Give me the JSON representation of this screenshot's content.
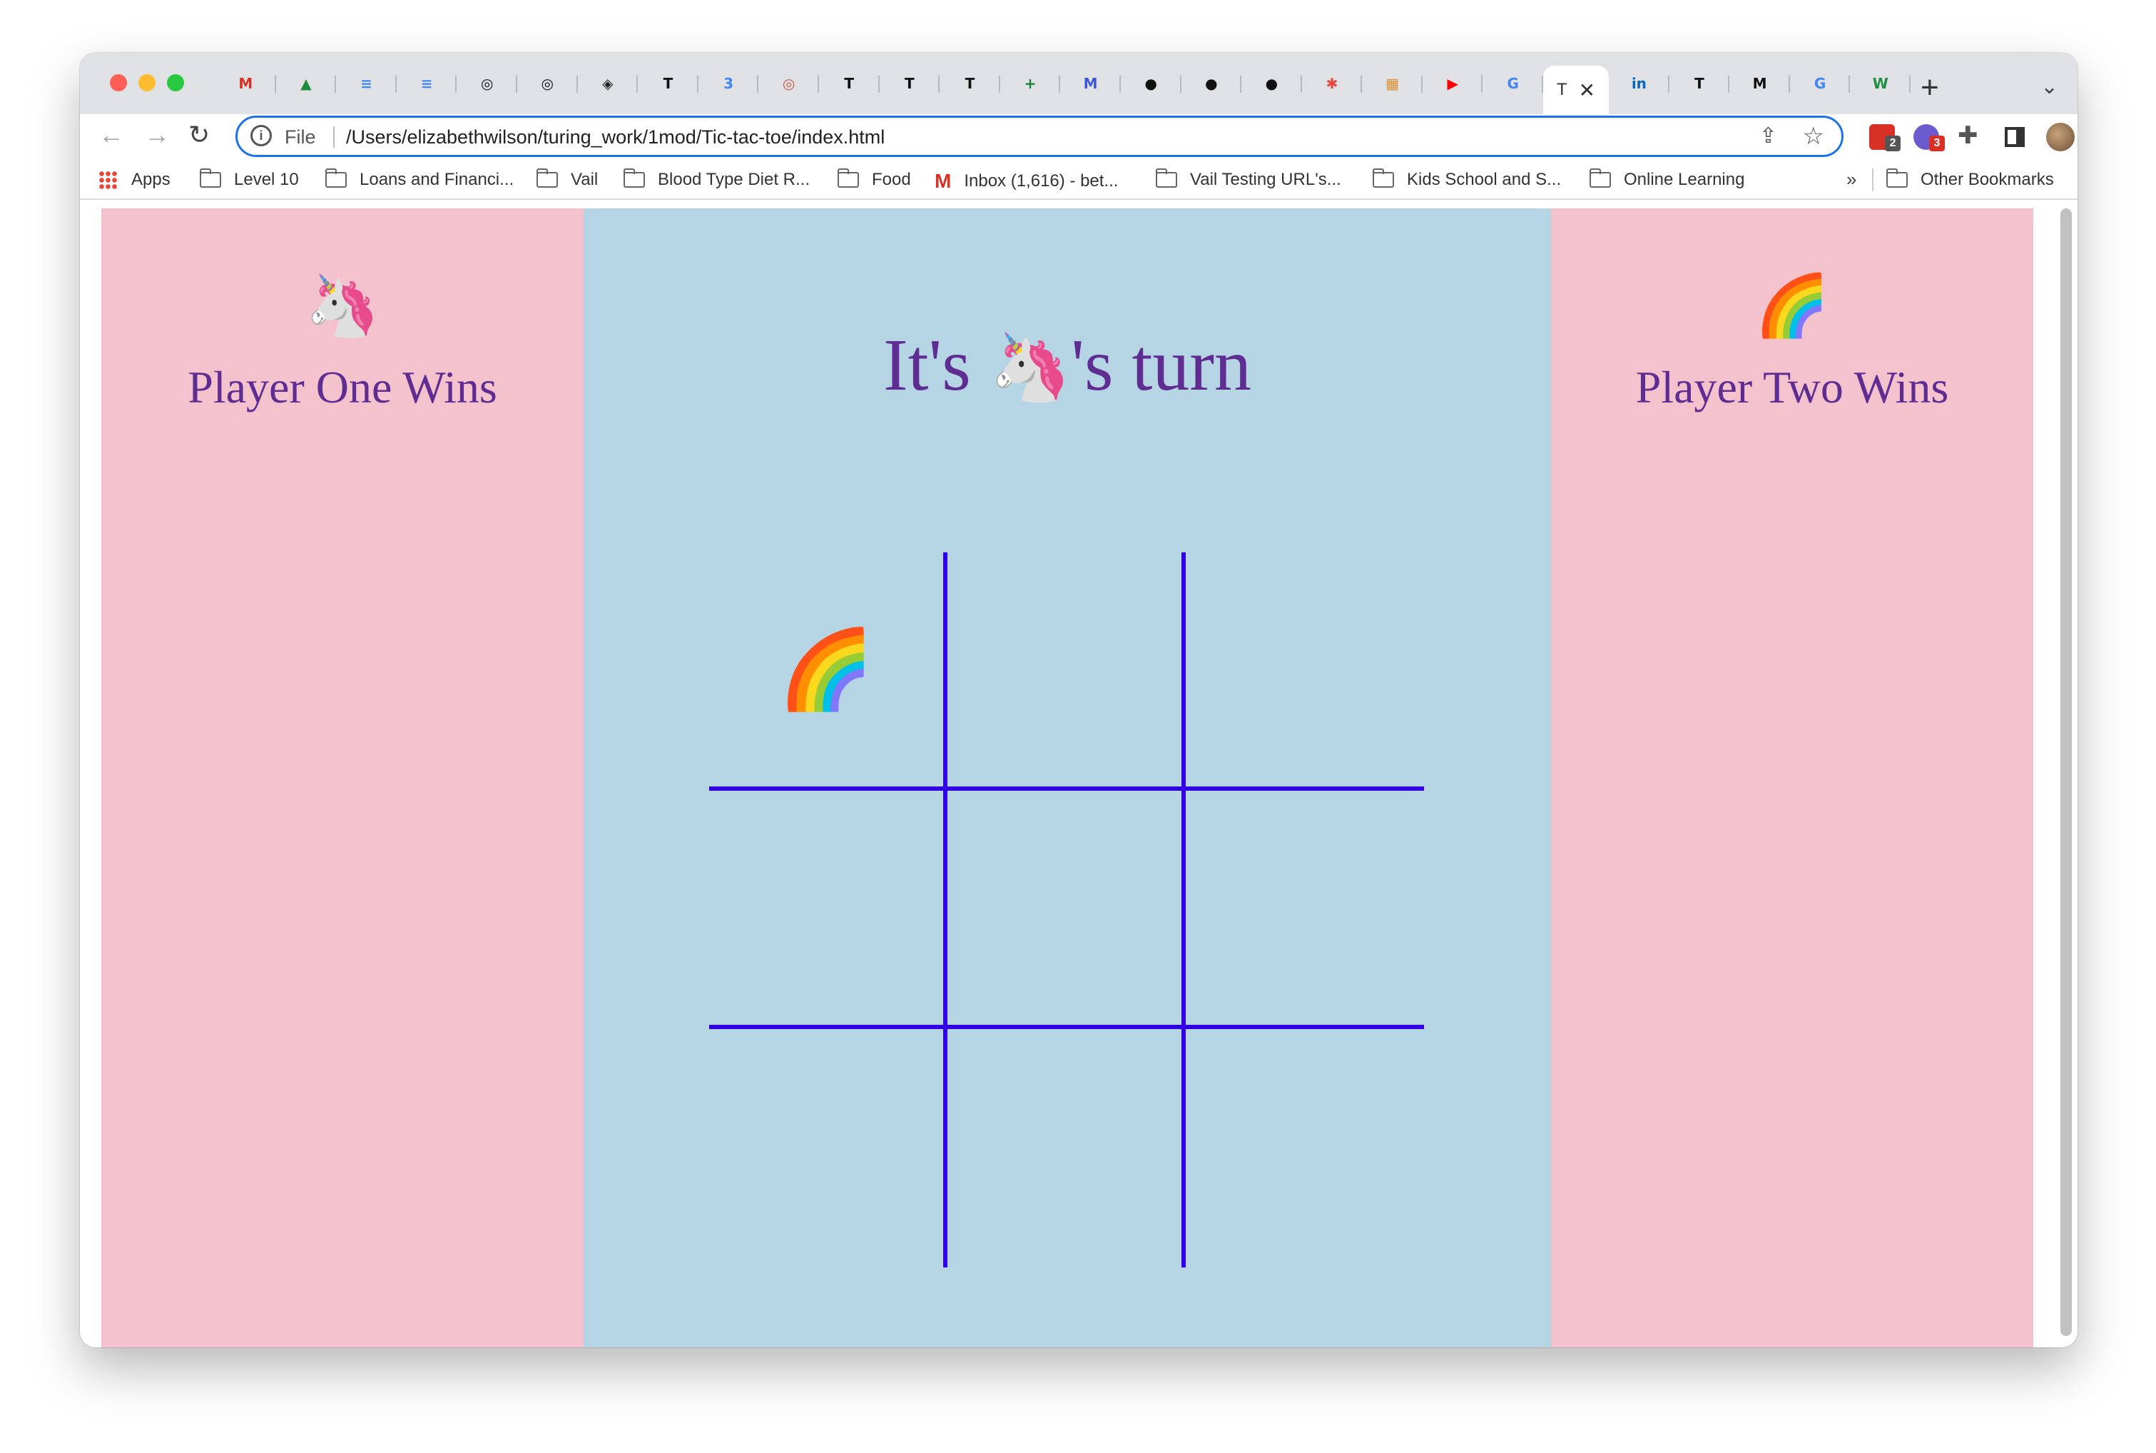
{
  "browser": {
    "tabs": [
      {
        "icon": "gmail-icon",
        "glyph": "M",
        "color": "#d93025"
      },
      {
        "icon": "google-drive-icon",
        "glyph": "▲",
        "color": "#1e8e3e"
      },
      {
        "icon": "google-docs-icon",
        "glyph": "≡",
        "color": "#4285f4"
      },
      {
        "icon": "google-docs-icon",
        "glyph": "≡",
        "color": "#4285f4"
      },
      {
        "icon": "openai-icon",
        "glyph": "◎",
        "color": "#111111"
      },
      {
        "icon": "openai-icon",
        "glyph": "◎",
        "color": "#111111"
      },
      {
        "icon": "codepen-icon",
        "glyph": "◈",
        "color": "#222222"
      },
      {
        "icon": "turing-icon",
        "glyph": "T",
        "color": "#111111"
      },
      {
        "icon": "google-calendar-icon",
        "glyph": "3",
        "color": "#4285f4"
      },
      {
        "icon": "openai-icon",
        "glyph": "◎",
        "color": "#c9574b"
      },
      {
        "icon": "turing-icon",
        "glyph": "T",
        "color": "#111111"
      },
      {
        "icon": "turing-icon",
        "glyph": "T",
        "color": "#111111"
      },
      {
        "icon": "turing-icon",
        "glyph": "T",
        "color": "#111111"
      },
      {
        "icon": "google-sheets-icon",
        "glyph": "+",
        "color": "#188038"
      },
      {
        "icon": "miro-icon",
        "glyph": "M",
        "color": "#3a57d6"
      },
      {
        "icon": "github-icon",
        "glyph": "●",
        "color": "#111111"
      },
      {
        "icon": "github-icon",
        "glyph": "●",
        "color": "#111111"
      },
      {
        "icon": "github-icon",
        "glyph": "●",
        "color": "#111111"
      },
      {
        "icon": "asterisk-icon",
        "glyph": "✱",
        "color": "#e8453c"
      },
      {
        "icon": "trello-icon",
        "glyph": "▦",
        "color": "#e0912f"
      },
      {
        "icon": "youtube-icon",
        "glyph": "▶",
        "color": "#ff0000"
      },
      {
        "icon": "google-icon",
        "glyph": "G",
        "color": "#4285f4"
      }
    ],
    "active_tab": {
      "title": "T",
      "close": "✕"
    },
    "tabs_after": [
      {
        "icon": "linkedin-icon",
        "glyph": "in",
        "color": "#0a66c2"
      },
      {
        "icon": "turing-icon",
        "glyph": "T",
        "color": "#111111"
      },
      {
        "icon": "medium-icon",
        "glyph": "M",
        "color": "#111111"
      },
      {
        "icon": "google-icon",
        "glyph": "G",
        "color": "#4285f4"
      },
      {
        "icon": "webflow-icon",
        "glyph": "W",
        "color": "#1e8e3e"
      }
    ],
    "new_tab": "+",
    "tab_search": "⌄",
    "omnibox": {
      "scheme_label": "File",
      "url": "/Users/elizabethwilson/turing_work/1mod/Tic-tac-toe/index.html"
    },
    "extension_badges": [
      "2",
      "3"
    ],
    "bookmarks": [
      {
        "label": "Apps",
        "type": "apps"
      },
      {
        "label": "Level 10",
        "type": "folder"
      },
      {
        "label": "Loans and Financi...",
        "type": "folder"
      },
      {
        "label": "Vail",
        "type": "folder"
      },
      {
        "label": "Blood Type Diet R...",
        "type": "folder"
      },
      {
        "label": "Food",
        "type": "folder"
      },
      {
        "label": "Inbox (1,616) - bet...",
        "type": "gmail"
      },
      {
        "label": "Vail Testing URL's...",
        "type": "folder"
      },
      {
        "label": "Kids School and S...",
        "type": "folder"
      },
      {
        "label": "Online Learning",
        "type": "folder"
      }
    ],
    "bookmarks_overflow": "»",
    "other_bookmarks": "Other Bookmarks"
  },
  "game": {
    "player_one": {
      "token": "🦄",
      "title": "Player One Wins"
    },
    "player_two": {
      "token": "🌈",
      "title": "Player Two Wins"
    },
    "turn": {
      "prefix": "It's ",
      "token": "🦄",
      "suffix": "'s turn"
    },
    "board": [
      "🌈",
      "",
      "",
      "",
      "",
      "",
      "",
      "",
      ""
    ],
    "colors": {
      "side_panel": "#f4c2cc",
      "center_panel": "#b5d5e5",
      "grid_lines": "#3300e6",
      "text": "#5f2d91"
    }
  }
}
